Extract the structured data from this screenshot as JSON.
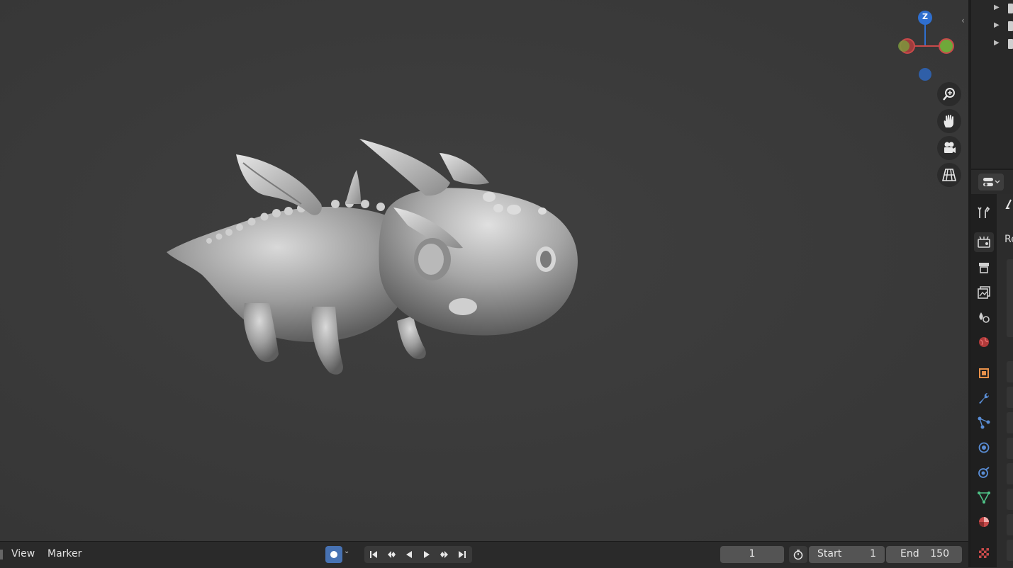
{
  "timeline": {
    "menu_view": "View",
    "menu_marker": "Marker",
    "current_frame": "1",
    "start_label": "Start",
    "start_value": "1",
    "end_label": "End",
    "end_value": "150"
  },
  "gizmo": {
    "z_label": "Z"
  },
  "properties": {
    "title": "Re"
  },
  "colors": {
    "accent": "#4772b3",
    "axis_x": "#c84a4a",
    "axis_y": "#6fa83a",
    "axis_z": "#2f6fcf"
  }
}
